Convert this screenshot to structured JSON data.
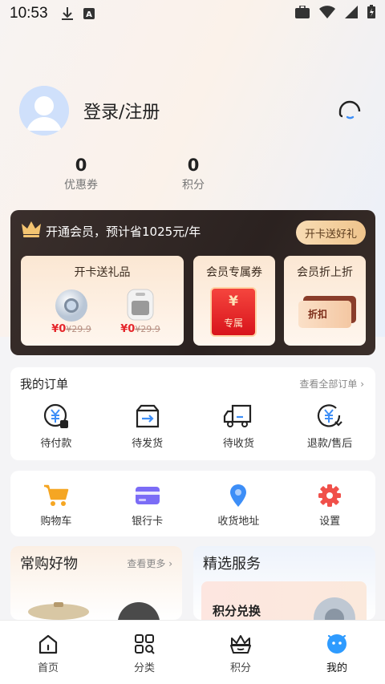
{
  "status_bar": {
    "time": "10:53"
  },
  "profile": {
    "login_text": "登录/注册"
  },
  "stats": [
    {
      "value": "0",
      "label": "优惠券"
    },
    {
      "value": "0",
      "label": "积分"
    }
  ],
  "vip": {
    "headline": "开通会员，预计省1025元/年",
    "cta": "开卡送好礼",
    "cards": {
      "gift": {
        "title": "开卡送礼品",
        "items": [
          {
            "now": "¥0",
            "old": "¥29.9"
          },
          {
            "now": "¥0",
            "old": "¥29.9"
          }
        ]
      },
      "coupon": {
        "title": "会员专属券",
        "badge": "专属",
        "currency": "¥"
      },
      "discount": {
        "title": "会员折上折",
        "ticket": "折扣"
      }
    }
  },
  "orders": {
    "title": "我的订单",
    "view_all": "查看全部订单",
    "items": [
      {
        "label": "待付款",
        "icon": "pending-payment-icon"
      },
      {
        "label": "待发货",
        "icon": "pending-shipment-icon"
      },
      {
        "label": "待收货",
        "icon": "delivery-truck-icon"
      },
      {
        "label": "退款/售后",
        "icon": "refund-icon"
      }
    ]
  },
  "tools": [
    {
      "label": "购物车",
      "icon": "cart-icon",
      "color": "#f5a623"
    },
    {
      "label": "银行卡",
      "icon": "bank-card-icon",
      "color": "#7b6cf6"
    },
    {
      "label": "收货地址",
      "icon": "location-icon",
      "color": "#3d8ef7"
    },
    {
      "label": "设置",
      "icon": "gear-icon",
      "color": "#f0504a"
    }
  ],
  "favorites": {
    "title": "常购好物",
    "more": "查看更多"
  },
  "services": {
    "title": "精选服务",
    "item": "积分兑换"
  },
  "tabbar": [
    {
      "label": "首页",
      "icon": "home-icon"
    },
    {
      "label": "分类",
      "icon": "category-icon"
    },
    {
      "label": "积分",
      "icon": "crown-basket-icon"
    },
    {
      "label": "我的",
      "icon": "mine-icon",
      "active": true
    }
  ]
}
